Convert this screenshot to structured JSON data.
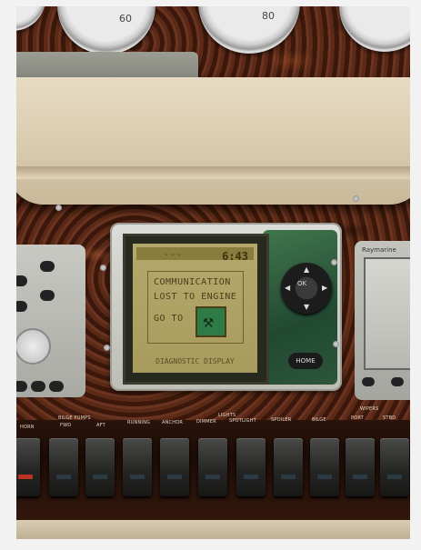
{
  "gauges": {
    "left_reading": "60",
    "center_reading": "80"
  },
  "display": {
    "time": "6:43",
    "dashes": "---",
    "message_line1": "COMMUNICATION",
    "message_line2": "LOST TO ENGINE",
    "message_line3": "GO TO",
    "footer": "DIAGNOSTIC DISPLAY",
    "ok_label": "OK",
    "home_label": "HOME",
    "tool_icon": "wrench-hammer-icon"
  },
  "side_device": {
    "brand": "Raymarine"
  },
  "switch_panel": {
    "group_labels": {
      "bilge_pumps": "BILGE  PUMPS",
      "lights": "LIGHTS",
      "wipers": "WIPERS"
    },
    "switch_labels": [
      "HORN",
      "FWD",
      "AFT",
      "RUNNING",
      "ANCHOR",
      "DIMMER",
      "SPOTLIGHT",
      "SPOILER",
      "BILGE",
      "PORT",
      "STBD"
    ]
  },
  "colors": {
    "wood": "#4a2212",
    "cream_dash": "#d9cbae",
    "lcd_background": "#b5a86c",
    "bezel_green": "#2f6b3c"
  }
}
